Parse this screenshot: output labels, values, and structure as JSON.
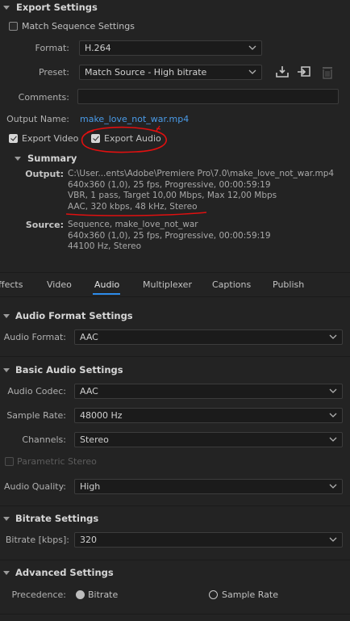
{
  "export_settings": {
    "title": "Export Settings",
    "match_sequence_label": "Match Sequence Settings",
    "format_label": "Format:",
    "format_value": "H.264",
    "preset_label": "Preset:",
    "preset_value": "Match Source - High bitrate",
    "comments_label": "Comments:",
    "comments_value": "",
    "output_name_label": "Output Name:",
    "output_name_value": "make_love_not_war.mp4",
    "export_video_label": "Export Video",
    "export_audio_label": "Export Audio",
    "icons": [
      "save-preset-icon",
      "import-preset-icon",
      "delete-preset-icon"
    ]
  },
  "summary": {
    "title": "Summary",
    "output_label": "Output:",
    "output_lines": [
      "C:\\User...ents\\Adobe\\Premiere Pro\\7.0\\make_love_not_war.mp4",
      "640x360 (1,0), 25 fps, Progressive, 00:00:59:19",
      "VBR, 1 pass, Target 10,00 Mbps, Max 12,00 Mbps",
      "AAC, 320 kbps, 48 kHz, Stereo"
    ],
    "source_label": "Source:",
    "source_lines": [
      "Sequence, make_love_not_war",
      "640x360 (1,0), 25 fps, Progressive, 00:00:59:19",
      "44100 Hz, Stereo"
    ]
  },
  "tabs": [
    {
      "label": "ffects"
    },
    {
      "label": "Video"
    },
    {
      "label": "Audio"
    },
    {
      "label": "Multiplexer"
    },
    {
      "label": "Captions"
    },
    {
      "label": "Publish"
    }
  ],
  "audio_format": {
    "title": "Audio Format Settings",
    "label": "Audio Format:",
    "value": "AAC"
  },
  "basic_audio": {
    "title": "Basic Audio Settings",
    "codec_label": "Audio Codec:",
    "codec_value": "AAC",
    "sample_rate_label": "Sample Rate:",
    "sample_rate_value": "48000 Hz",
    "channels_label": "Channels:",
    "channels_value": "Stereo",
    "parametric_label": "Parametric Stereo",
    "quality_label": "Audio Quality:",
    "quality_value": "High"
  },
  "bitrate": {
    "title": "Bitrate Settings",
    "label": "Bitrate [kbps]:",
    "value": "320"
  },
  "advanced": {
    "title": "Advanced Settings",
    "precedence_label": "Precedence:",
    "option_bitrate": "Bitrate",
    "option_sample_rate": "Sample Rate"
  },
  "colors": {
    "background": "#232323",
    "link": "#4a9be8",
    "tab_underline": "#2d8ceb",
    "annotation": "#e01010"
  }
}
